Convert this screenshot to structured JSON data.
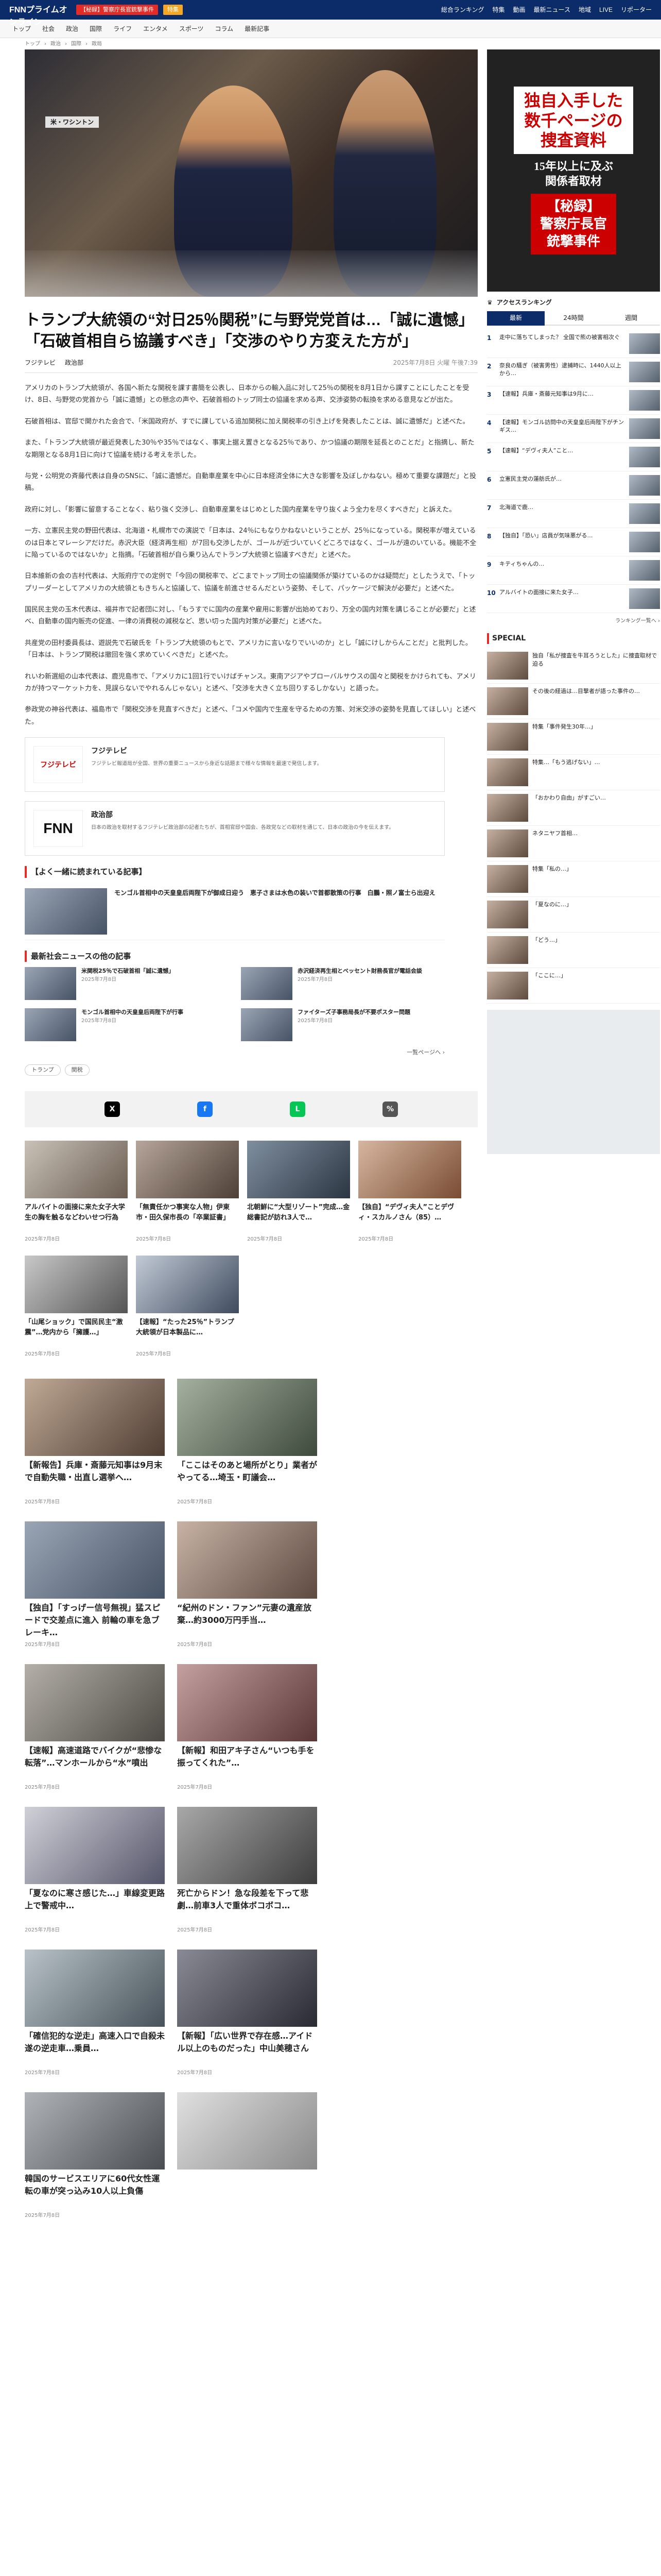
{
  "header": {
    "logo": "FNNプライムオンライン",
    "special": "【秘録】警察庁長官銃撃事件",
    "badge": "特集",
    "nav": [
      "総合ランキング",
      "特集",
      "動画",
      "最新ニュース",
      "地域",
      "LIVE",
      "リポーター"
    ]
  },
  "subnav": [
    "トップ",
    "社会",
    "政治",
    "国際",
    "ライフ",
    "エンタメ",
    "スポーツ",
    "コラム",
    "最新記事"
  ],
  "breadcrumb": [
    "トップ",
    "政治",
    "国際",
    "政局"
  ],
  "hero": {
    "tag": "米・ワシントン"
  },
  "article": {
    "title": "トランプ大統領の“対日25％関税”に与野党党首は…「誠に遺憾」「石破首相自ら協議すべき」「交渉のやり方変えた方が」",
    "source": "フジテレビ",
    "section": "政治部",
    "date": "2025年7月8日 火曜 午後7:39",
    "paragraphs": [
      "アメリカのトランプ大統領が、各国へ新たな関税を課す書簡を公表し、日本からの輸入品に対して25％の関税を8月1日から課すことにしたことを受け、8日、与野党の党首から「誠に遺憾」との懸念の声や、石破首相のトップ同士の協議を求める声、交渉姿勢の転換を求める意見などが出た。",
      "石破首相は、官邸で開かれた会合で、「米国政府が、すでに課している追加関税に加え関税率の引き上げを発表したことは、誠に遺憾だ」と述べた。",
      "また、「トランプ大統領が最近発表した30％や35％ではなく、事実上据え置きとなる25％であり、かつ協議の期限を延長とのことだ」と指摘し、新たな期限となる8月1日に向けて協議を続ける考えを示した。",
      "与党・公明党の斉藤代表は自身のSNSに、「誠に遺憾だ。自動車産業を中心に日本経済全体に大きな影響を及ぼしかねない。極めて重要な課題だ」と投稿。",
      "政府に対し、「影響に留意することなく、粘り強く交渉し、自動車産業をはじめとした国内産業を守り抜くよう全力を尽くすべきだ」と訴えた。",
      "一方、立憲民主党の野田代表は、北海道・札幌市での演説で「日本は、24％にもなりかねないということが、25％になっている。関税率が増えているのは日本とマレーシアだけだ。赤沢大臣（経済再生相）が7回も交渉したが、ゴールが近づいていくどころではなく、ゴールが遠のいている。機能不全に陥っているのではないか」と指摘。「石破首相が自ら乗り込んでトランプ大統領と協議すべきだ」と述べた。",
      "日本維新の会の吉村代表は、大阪府庁での定例で「今回の関税率で、どこまでトップ同士の協議関係が築けているのかは疑問だ」としたうえで、「トップリーダーとしてアメリカの大統領ともきちんと協議して、協議を前進させるんだという姿勢、そして、パッケージで解決が必要だ」と述べた。",
      "国民民主党の玉木代表は、福井市で記者団に対し、「もうすでに国内の産業や雇用に影響が出始めており、万全の国内対策を講じることが必要だ」と述べ、自動車の国内販売の促進、一律の消費税の減税など、思い切った国内対策が必要だ」と述べた。",
      "共産党の田村委員長は、遊説先で石破氏を「トランプ大統領のもとで、アメリカに言いなりでいいのか」とし「誠にけしからんことだ」と批判した。「日本は、トランプ関税は撤回を強く求めていくべきだ」と述べた。",
      "れいわ新選組の山本代表は、鹿児島市で、「アメリカに1回1行でいけばチャンス。東南アジアやブローバルサウスの国々と関税をかけられても、アメリカが持つマーケット力を、見誤らないでやれるんじゃない」と述べ、「交渉を大きく立ち回りするしかない」と語った。",
      "参政党の神谷代表は、福島市で「関税交渉を見直すべきだ」と述べ、「コメや国内で生産を守るための方策、対米交渉の姿勢を見直してほしい」と述べた。"
    ]
  },
  "sources": [
    {
      "logo": "フジテレビ",
      "name": "フジテレビ",
      "desc": "フジテレビ報道局が全国、世界の重要ニュースから身近な話題まで様々な情報を最速で発信します。"
    },
    {
      "logo": "FNN",
      "name": "政治部",
      "desc": "日本の政治を取材するフジテレビ政治部の記者たちが、首相官邸や国会、各政党などの取材を通じて、日本の政治の今を伝えます。"
    }
  ],
  "related_head": "【よく一緒に読まれている記事】",
  "related_main": {
    "text": "モンゴル首相中の天皇皇后両陛下が御成日迎う　恵子さまは水色の装いで首都散策の行事　白鵬・照ノ富士ら出迎え",
    "date": ""
  },
  "latest_head": "最新社会ニュースの他の記事",
  "latest": [
    {
      "text": "米関税25％で石破首相「誠に遺憾」",
      "date": "2025年7月8日"
    },
    {
      "text": "赤沢経済再生相とベッセント財務長官が電話会談",
      "date": "2025年7月8日"
    },
    {
      "text": "モンゴル首相中の天皇皇后両陛下が行事",
      "date": "2025年7月8日"
    },
    {
      "text": "ファイターズ子事務局長が不要ポスター問題",
      "date": "2025年7月8日"
    }
  ],
  "more_label": "一覧ページへ",
  "tags": [
    "トランプ",
    "関税"
  ],
  "share": [
    "X",
    "f",
    "L",
    "%"
  ],
  "cards": [
    {
      "title": "アルバイトの面接に来た女子大学生の胸を触るなどわいせつ行為",
      "date": "2025年7月8日"
    },
    {
      "title": "「無責任かつ事実な人物」伊東市・田久保市長の「卒業証書」",
      "date": "2025年7月8日"
    },
    {
      "title": "北朝鮮に“大型リゾート”完成…金総書記が訪れ3人で…",
      "date": "2025年7月8日"
    },
    {
      "title": "【独自】“デヴィ夫人”ことデヴィ・スカルノさん（85）…",
      "date": "2025年7月8日"
    },
    {
      "title": "「山尾ショック」で国民民主“激震”…党内から「擁護…」",
      "date": "2025年7月8日"
    },
    {
      "title": "【速報】“たった25％”トランプ大統領が日本製品に…",
      "date": "2025年7月8日"
    }
  ],
  "cards2": [
    {
      "title": "【新報告】兵庫・斎藤元知事は9月末で自動失職・出直し選挙へ…",
      "date": "2025年7月8日"
    },
    {
      "title": "「ここはそのあと場所がとり」業者がやってる…埼玉・町議会…",
      "date": "2025年7月8日"
    },
    {
      "title": "【独自】「すっげー信号無視」猛スピードで交差点に進入 前輪の車を急ブレーキ…",
      "date": "2025年7月8日"
    },
    {
      "title": "“紀州のドン・ファン”元妻の遺産放棄…約3000万円手当…",
      "date": "2025年7月8日"
    },
    {
      "title": "【速報】高速道路でバイクが“悲惨な転落”…マンホールから“水”噴出",
      "date": "2025年7月8日"
    },
    {
      "title": "【新報】和田アキ子さん“いつも手を振ってくれた”…",
      "date": "2025年7月8日"
    },
    {
      "title": "「夏なのに寒さ感じた…」車線変更路上で警戒中…",
      "date": "2025年7月8日"
    },
    {
      "title": "死亡からドン！急な段差を下って悲劇…前車3人で重体ボコボコ…",
      "date": "2025年7月8日"
    },
    {
      "title": "「確信犯的な逆走」高速入口で自殺未遂の逆走車…乗員…",
      "date": "2025年7月8日"
    },
    {
      "title": "【新報】「広い世界で存在感…アイドル以上のものだった」中山美穂さん",
      "date": "2025年7月8日"
    },
    {
      "title": "韓国のサービスエリアに60代女性運転の車が突っ込み10人以上負傷",
      "date": "2025年7月8日"
    },
    {
      "title": "",
      "date": ""
    }
  ],
  "sidebar_ad": {
    "line1": "独自入手した",
    "line2": "数千ページの",
    "line3": "捜査資料",
    "line4": "15年以上に及ぶ",
    "line5": "関係者取材",
    "line6": "【秘録】",
    "line7": "警察庁長官",
    "line8": "銃撃事件"
  },
  "ranking": {
    "title": "アクセスランキング",
    "tabs": [
      "最新",
      "24時間",
      "週間"
    ],
    "items": [
      "走中に落ちてしまった？ 全国で熊の被害相次ぐ",
      "奈良の騒ぎ（被害男性）逮捕時に、1440人以上から…",
      "【速報】兵庫・斎藤元知事は9月に…",
      "【速報】モンゴル訪問中の天皇皇后両陛下がチンギス…",
      "【速報】“デヴィ夫人”こと…",
      "立憲民主党の蓮舫氏が…",
      "北海道で鹿…",
      "【独自】「恐い」店員が気味悪がる…",
      "キティちゃんの…",
      "アルバイトの面接に来た女子…"
    ],
    "more": "ランキング一覧へ"
  },
  "special": {
    "title": "SPECIAL",
    "items": [
      "独自「私が捜査を牛耳ろうとした」に捜査取材で迫る",
      "その後の経過は…目撃者が語った事件の…",
      "特集「事件発生30年…」",
      "特集…「もう逃げない」…",
      "「おかわり自由」がすごい…",
      "ネタニヤフ首相…",
      "特集「私の…」",
      "「夏なのに…」",
      "「どう…」",
      "「ここに…」"
    ]
  }
}
